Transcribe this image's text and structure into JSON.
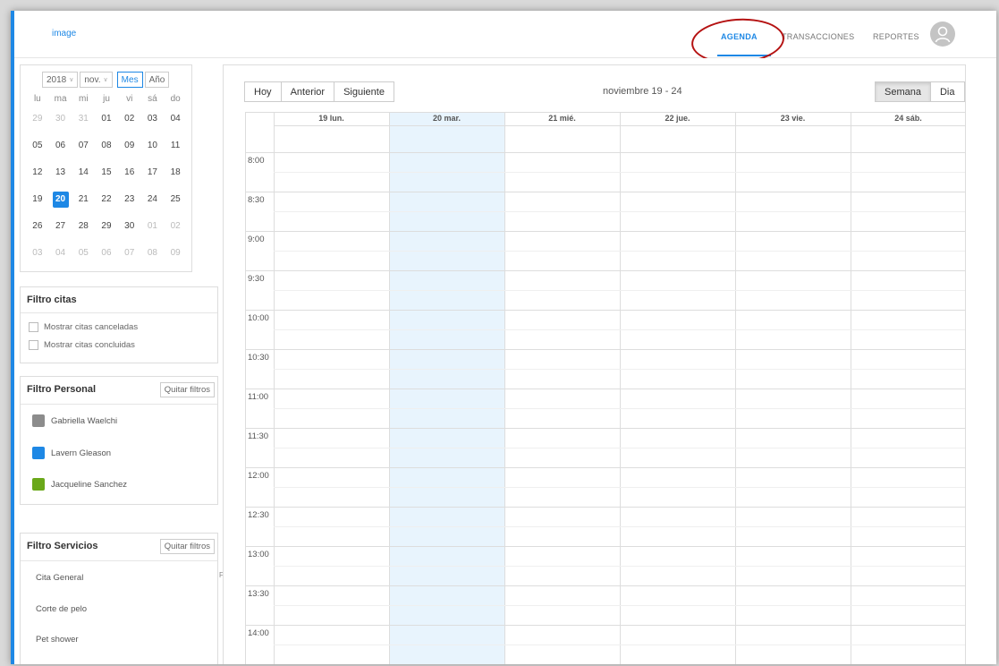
{
  "app": {
    "logo_text": "image",
    "nav": [
      {
        "label": "AGENDA",
        "active": true
      },
      {
        "label": "TRANSACCIONES",
        "active": false
      },
      {
        "label": "REPORTES",
        "active": false
      }
    ],
    "avatar_icon": "user-icon"
  },
  "mini_calendar": {
    "year": "2018",
    "month": "nov.",
    "mode_buttons": [
      {
        "label": "Mes",
        "active": true
      },
      {
        "label": "Año",
        "active": false
      }
    ],
    "weekdays": [
      "lu",
      "ma",
      "mi",
      "ju",
      "vi",
      "sá",
      "do"
    ],
    "weeks": [
      [
        "29",
        "30",
        "31",
        "01",
        "02",
        "03",
        "04"
      ],
      [
        "05",
        "06",
        "07",
        "08",
        "09",
        "10",
        "11"
      ],
      [
        "12",
        "13",
        "14",
        "15",
        "16",
        "17",
        "18"
      ],
      [
        "19",
        "20",
        "21",
        "22",
        "23",
        "24",
        "25"
      ],
      [
        "26",
        "27",
        "28",
        "29",
        "30",
        "01",
        "02"
      ],
      [
        "03",
        "04",
        "05",
        "06",
        "07",
        "08",
        "09"
      ]
    ],
    "selected": "20"
  },
  "filtro_citas": {
    "title": "Filtro citas",
    "options": [
      "Mostrar citas canceladas",
      "Mostrar citas concluidas"
    ]
  },
  "filtro_personal": {
    "title": "Filtro Personal",
    "clear_label": "Quitar filtros",
    "staff": [
      {
        "name": "Gabriella Waelchi",
        "color": "#8c8c8c"
      },
      {
        "name": "Lavern Gleason",
        "color": "#1e88e5"
      },
      {
        "name": "Jacqueline Sanchez",
        "color": "#6aa81a"
      }
    ]
  },
  "stray_char": "F",
  "filtro_servicios": {
    "title": "Filtro Servicios",
    "clear_label": "Quitar filtros",
    "services": [
      "Cita General",
      "Corte de pelo",
      "Pet shower"
    ]
  },
  "calendar": {
    "nav_buttons": [
      "Hoy",
      "Anterior",
      "Siguiente"
    ],
    "title": "noviembre 19 - 24",
    "view_buttons": [
      {
        "label": "Semana",
        "active": true
      },
      {
        "label": "Dia",
        "active": false
      }
    ],
    "days": [
      "19 lun.",
      "20 mar.",
      "21 mié.",
      "22 jue.",
      "23 vie.",
      "24 sáb."
    ],
    "today_index": 1,
    "times": [
      "8:00",
      "8:30",
      "9:00",
      "9:30",
      "10:00",
      "10:30",
      "11:00",
      "11:30",
      "12:00",
      "12:30",
      "13:00",
      "13:30",
      "14:00"
    ]
  },
  "colors": {
    "accent": "#1e88e5",
    "today_bg": "#e8f4fd",
    "annotation": "#b51212"
  }
}
